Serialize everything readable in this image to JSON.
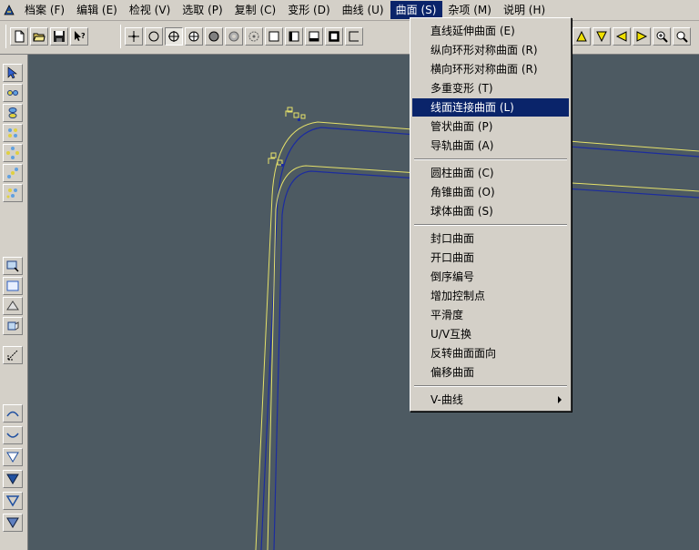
{
  "menubar": {
    "items": [
      {
        "label": "档案 (F)"
      },
      {
        "label": "编辑 (E)"
      },
      {
        "label": "检视 (V)"
      },
      {
        "label": "选取 (P)"
      },
      {
        "label": "复制 (C)"
      },
      {
        "label": "变形 (D)"
      },
      {
        "label": "曲线 (U)"
      },
      {
        "label": "曲面 (S)",
        "active": true
      },
      {
        "label": "杂项 (M)"
      },
      {
        "label": "说明 (H)"
      }
    ]
  },
  "surface_menu": {
    "groups": [
      [
        {
          "label": "直线延伸曲面 (E)"
        },
        {
          "label": "纵向环形对称曲面 (R)"
        },
        {
          "label": "横向环形对称曲面 (R)"
        },
        {
          "label": "多重变形 (T)"
        },
        {
          "label": "线面连接曲面 (L)",
          "highlight": true
        },
        {
          "label": "管状曲面 (P)"
        },
        {
          "label": "导轨曲面 (A)"
        }
      ],
      [
        {
          "label": "圆柱曲面 (C)"
        },
        {
          "label": "角锥曲面 (O)"
        },
        {
          "label": "球体曲面 (S)"
        }
      ],
      [
        {
          "label": "封口曲面"
        },
        {
          "label": "开口曲面"
        },
        {
          "label": "倒序编号"
        },
        {
          "label": "增加控制点"
        },
        {
          "label": "平滑度"
        },
        {
          "label": "U/V互换"
        },
        {
          "label": "反转曲面面向"
        },
        {
          "label": "偏移曲面"
        }
      ],
      [
        {
          "label": "V-曲线",
          "submenu": true
        }
      ]
    ]
  },
  "colors": {
    "viewport_bg": "#4d5a62",
    "curve_yellow": "#e6e26a",
    "curve_blue": "#1c2c9e",
    "menu_highlight": "#0a246a"
  },
  "toolbar": {
    "icons": [
      "new-file-icon",
      "open-folder-icon",
      "save-disk-icon",
      "help-pointer-icon",
      "point-snap-icon",
      "circle-icon",
      "center-snap-icon",
      "grid-snap-icon",
      "sphere-icon",
      "ring-icon",
      "rotate-icon",
      "frame-icon",
      "frame-left-icon",
      "frame-bottom-icon",
      "frame-bold-icon",
      "frame-partial-icon",
      "triangle-up-icon",
      "triangle-down-icon",
      "triangle-left-icon",
      "triangle-right-icon",
      "zoom-in-icon",
      "zoom-fit-icon"
    ]
  },
  "palette": {
    "icons": [
      "select-arrow-icon",
      "node-chain-icon",
      "vertical-nodes-icon",
      "node-grid-icon",
      "node-diamond-icon",
      "node-scatter-icon",
      "node-cluster-icon",
      "zoom-window-icon",
      "rectangle-icon",
      "pyramid-icon",
      "face-icon",
      "axis-icon",
      "arc-up-icon",
      "arc-down-icon",
      "funnel-icon",
      "funnel-bold-icon",
      "funnel-outline-icon",
      "funnel-down-icon"
    ]
  }
}
